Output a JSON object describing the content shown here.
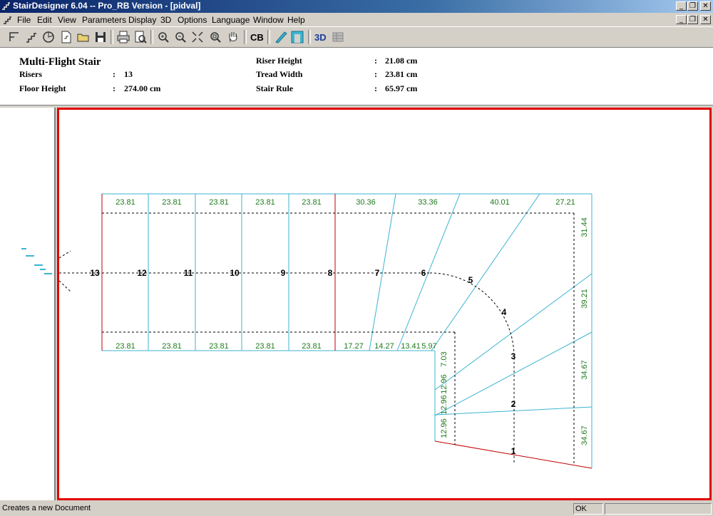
{
  "window": {
    "title": "StairDesigner 6.04 -- Pro_RB Version - [pidval]",
    "minimize": "_",
    "restore": "❐",
    "close": "✕"
  },
  "menu": [
    "File",
    "Edit",
    "View",
    "Parameters",
    "Display",
    "3D",
    "Options",
    "Language",
    "Window",
    "Help"
  ],
  "toolbar": {
    "cb_label": "CB",
    "threed_label": "3D"
  },
  "info": {
    "title": "Multi-Flight Stair",
    "risers_label": "Risers",
    "risers_value": "13",
    "floor_label": "Floor Height",
    "floor_value": "274.00 cm",
    "riser_height_label": "Riser Height",
    "riser_height_value": "21.08 cm",
    "tread_label": "Tread Width",
    "tread_value": "23.81 cm",
    "rule_label": "Stair Rule",
    "rule_value": "65.97 cm",
    "colon": ":"
  },
  "drawing": {
    "top_widths": [
      "23.81",
      "23.81",
      "23.81",
      "23.81",
      "23.81",
      "30.36",
      "33.36",
      "40.01",
      "27.21"
    ],
    "bottom_widths": [
      "23.81",
      "23.81",
      "23.81",
      "23.81",
      "23.81",
      "17.27",
      "14.27",
      "13.41",
      "5.97"
    ],
    "right_widths": [
      "31.44",
      "39.21",
      "34.67",
      "34.67"
    ],
    "inner_widths": [
      "7.03",
      "12.96",
      "12.96",
      "12.96"
    ],
    "step_numbers": [
      "13",
      "12",
      "11",
      "10",
      "9",
      "8",
      "7",
      "6",
      "5",
      "4",
      "3",
      "2",
      "1"
    ],
    "colors": {
      "line": "#3cb4d2",
      "frame": "#e00000",
      "dim_text": "#1e7a1e",
      "accent_red": "#c00000"
    }
  },
  "status": {
    "message": "Creates a new Document",
    "ok": "OK"
  }
}
